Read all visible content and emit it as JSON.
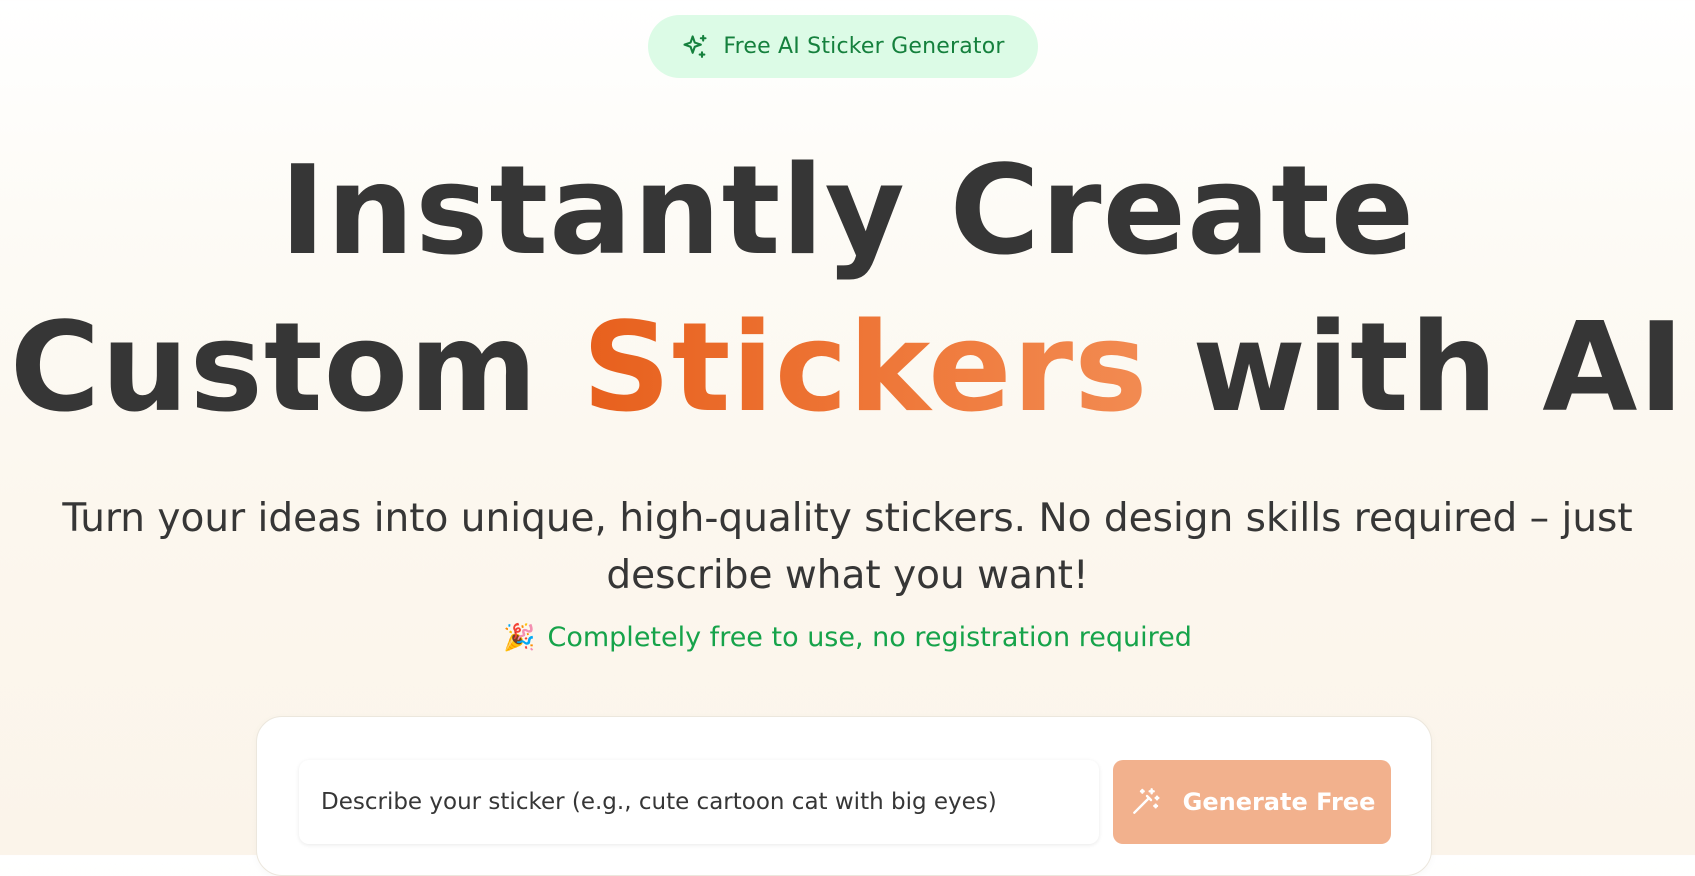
{
  "badge": {
    "icon": "sparkles-icon",
    "label": "Free AI Sticker Generator",
    "background": "#dcfbe6",
    "color": "#15803d"
  },
  "headline": {
    "line1": "Instantly Create",
    "line2_before": "Custom ",
    "line2_accent": "Stickers",
    "line2_after": " with AI",
    "color": "#363636",
    "accent_color": "#e7601d"
  },
  "subtitle": "Turn your ideas into unique, high-quality stickers. No design skills required – just describe what you want!",
  "free_note": {
    "icon": "party-popper-icon",
    "emoji": "🎉",
    "text": "Completely free to use, no registration required",
    "color": "#16a34a"
  },
  "generator": {
    "input_placeholder": "Describe your sticker (e.g., cute cartoon cat with big eyes)",
    "input_value": "",
    "button_icon": "magic-wand-icon",
    "button_label": "Generate Free",
    "button_color": "#f2b18d"
  }
}
